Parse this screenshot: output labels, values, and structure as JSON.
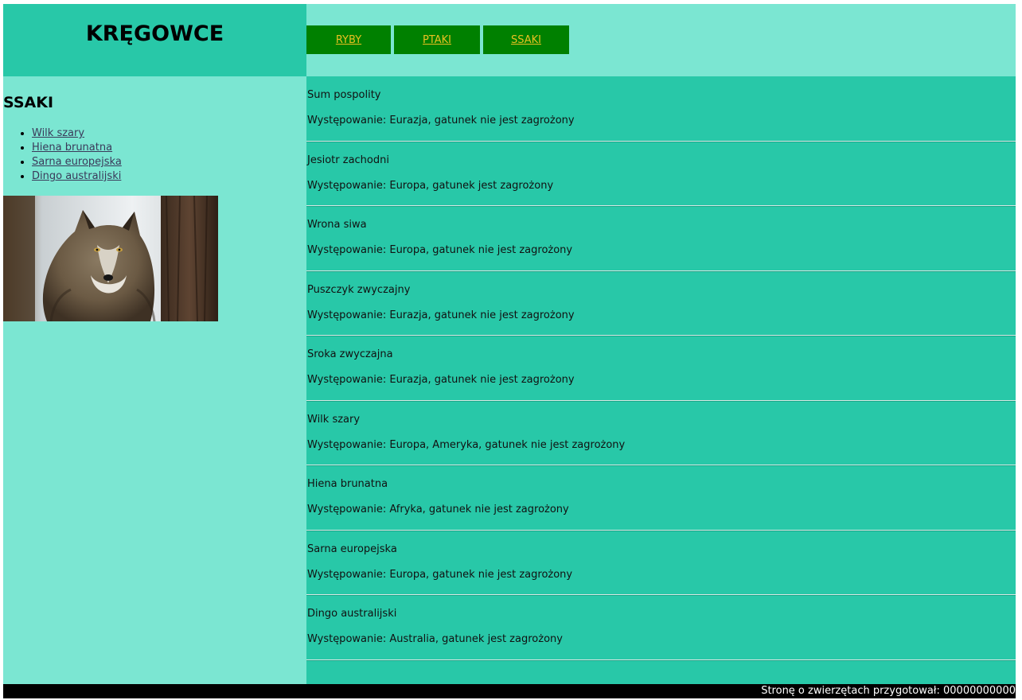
{
  "header": {
    "title": "KRĘGOWCE"
  },
  "menu": {
    "items": [
      {
        "label": "RYBY"
      },
      {
        "label": "PTAKI"
      },
      {
        "label": "SSAKI"
      }
    ]
  },
  "sidebar": {
    "heading": "SSAKI",
    "links": [
      {
        "label": "Wilk szary"
      },
      {
        "label": "Hiena brunatna"
      },
      {
        "label": "Sarna europejska"
      },
      {
        "label": "Dingo australijski"
      }
    ],
    "image": "wolf-photo"
  },
  "animals": [
    {
      "name": "Sum pospolity",
      "description": "Występowanie: Eurazja, gatunek nie jest zagrożony"
    },
    {
      "name": "Jesiotr zachodni",
      "description": "Występowanie: Europa, gatunek jest zagrożony"
    },
    {
      "name": "Wrona siwa",
      "description": "Występowanie: Europa, gatunek nie jest zagrożony"
    },
    {
      "name": "Puszczyk zwyczajny",
      "description": "Występowanie: Eurazja, gatunek nie jest zagrożony"
    },
    {
      "name": "Sroka zwyczajna",
      "description": "Występowanie: Eurazja, gatunek nie jest zagrożony"
    },
    {
      "name": "Wilk szary",
      "description": "Występowanie: Europa, Ameryka, gatunek nie jest zagrożony"
    },
    {
      "name": "Hiena brunatna",
      "description": "Występowanie: Afryka, gatunek nie jest zagrożony"
    },
    {
      "name": "Sarna europejska",
      "description": "Występowanie: Europa, gatunek nie jest zagrożony"
    },
    {
      "name": "Dingo australijski",
      "description": "Występowanie: Australia, gatunek jest zagrożony"
    }
  ],
  "footer": {
    "text": "Stronę o zwierzętach przygotował: 00000000000"
  },
  "colors": {
    "dark_teal": "#28c8a8",
    "light_teal": "#7be6d2",
    "menu_green": "#008000",
    "menu_link": "#e8c020"
  }
}
